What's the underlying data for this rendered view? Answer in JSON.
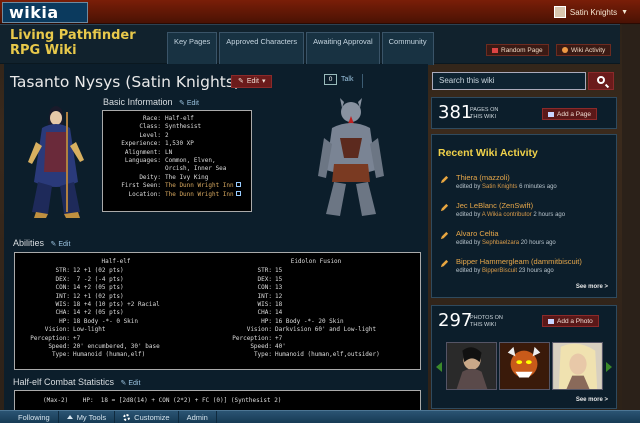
{
  "topbar": {
    "logo": "wikia",
    "user": "Satin Knights"
  },
  "wiki": {
    "title": "Living Pathfinder RPG Wiki",
    "tabs": [
      "Key Pages",
      "Approved Characters",
      "Awaiting Approval",
      "Community"
    ],
    "random_page": "Random Page",
    "wiki_activity": "Wiki Activity"
  },
  "article": {
    "title": "Tasanto Nysys (Satin Knights)",
    "edit_label": "Edit",
    "talk_count": "0",
    "talk_label": "Talk",
    "basic_info_heading": "Basic Information",
    "abilities_heading": "Abilities",
    "combat_heading": "Half-elf Combat Statistics",
    "section_edit": "Edit",
    "basic_info": [
      {
        "k": "Race:",
        "v": "Half-elf"
      },
      {
        "k": "Class:",
        "v": "Synthesist"
      },
      {
        "k": "Level:",
        "v": "2"
      },
      {
        "k": "Experience:",
        "v": "1,530 XP"
      },
      {
        "k": "Alignment:",
        "v": "LN"
      },
      {
        "k": "Languages:",
        "v": "Common, Elven,"
      },
      {
        "k": "",
        "v": "Orcish, Inner Sea"
      },
      {
        "k": "Deity:",
        "v": "The Ivy King"
      },
      {
        "k": "First Seen:",
        "v": "The Dunn Wright Inn",
        "link": true
      },
      {
        "k": "Location:",
        "v": "The Dunn Wright Inn",
        "link": true
      }
    ],
    "abilities_left": {
      "header": "Half-elf",
      "rows": [
        {
          "k": "STR:",
          "v": "12 +1 (02 pts)"
        },
        {
          "k": "DEX:",
          "v": " 7 -2 (-4 pts)"
        },
        {
          "k": "CON:",
          "v": "14 +2 (05 pts)"
        },
        {
          "k": "INT:",
          "v": "12 +1 (02 pts)"
        },
        {
          "k": "WIS:",
          "v": "18 +4 (10 pts) +2 Racial"
        },
        {
          "k": "CHA:",
          "v": "14 +2 (05 pts)"
        },
        {
          "k": "HP:",
          "v": "18 Body -*- 0 Skin"
        },
        {
          "k": "Vision:",
          "v": "Low-light"
        },
        {
          "k": "Perception:",
          "v": "+7"
        },
        {
          "k": "Speed:",
          "v": "20' encumbered, 30' base"
        },
        {
          "k": "Type:",
          "v": "Humanoid (human,elf)"
        }
      ]
    },
    "abilities_right": {
      "header": "Eidolon Fusion",
      "rows": [
        {
          "k": "STR:",
          "v": "15"
        },
        {
          "k": "DEX:",
          "v": "15"
        },
        {
          "k": "CON:",
          "v": "13"
        },
        {
          "k": "INT:",
          "v": "12"
        },
        {
          "k": "WIS:",
          "v": "18"
        },
        {
          "k": "CHA:",
          "v": "14"
        },
        {
          "k": "HP:",
          "v": "16 Body -*- 20 Skin"
        },
        {
          "k": "Vision:",
          "v": "Darkvision 60' and Low-light"
        },
        {
          "k": "Perception:",
          "v": "+7"
        },
        {
          "k": "Speed:",
          "v": "40'"
        },
        {
          "k": "Type:",
          "v": "Humanoid (human,elf,outsider)"
        }
      ]
    },
    "combat_line": "(Max-2)    HP:  18 = [2d8(14) + CON (2*2) + FC (0)] (Synthesist 2)"
  },
  "rail": {
    "search_placeholder": "Search this wiki",
    "pages_count": "381",
    "pages_caption_1": "PAGES ON",
    "pages_caption_2": "THIS WIKI",
    "add_page": "Add a Page",
    "activity_title": "Recent Wiki Activity",
    "activity": [
      {
        "title": "Thiera (mazzoli)",
        "by": "edited by",
        "user": "Satin Knights",
        "when": "6 minutes ago"
      },
      {
        "title": "Jec LeBlanc (ZenSwift)",
        "by": "edited by",
        "user": "A Wikia contributor",
        "when": "2 hours ago"
      },
      {
        "title": "Alvaro Celtia",
        "by": "edited by",
        "user": "Sephbaelzara",
        "when": "20 hours ago"
      },
      {
        "title": "Bipper Hammergleam (dammitbiscuit)",
        "by": "edited by",
        "user": "BipperBiscuit",
        "when": "23 hours ago"
      }
    ],
    "see_more": "See more >",
    "photos_count": "297",
    "photos_caption_1": "PHOTOS ON",
    "photos_caption_2": "THIS WIKI",
    "add_photo": "Add a Photo"
  },
  "toolbar": {
    "following": "Following",
    "my_tools": "My Tools",
    "customize": "Customize",
    "admin": "Admin"
  }
}
